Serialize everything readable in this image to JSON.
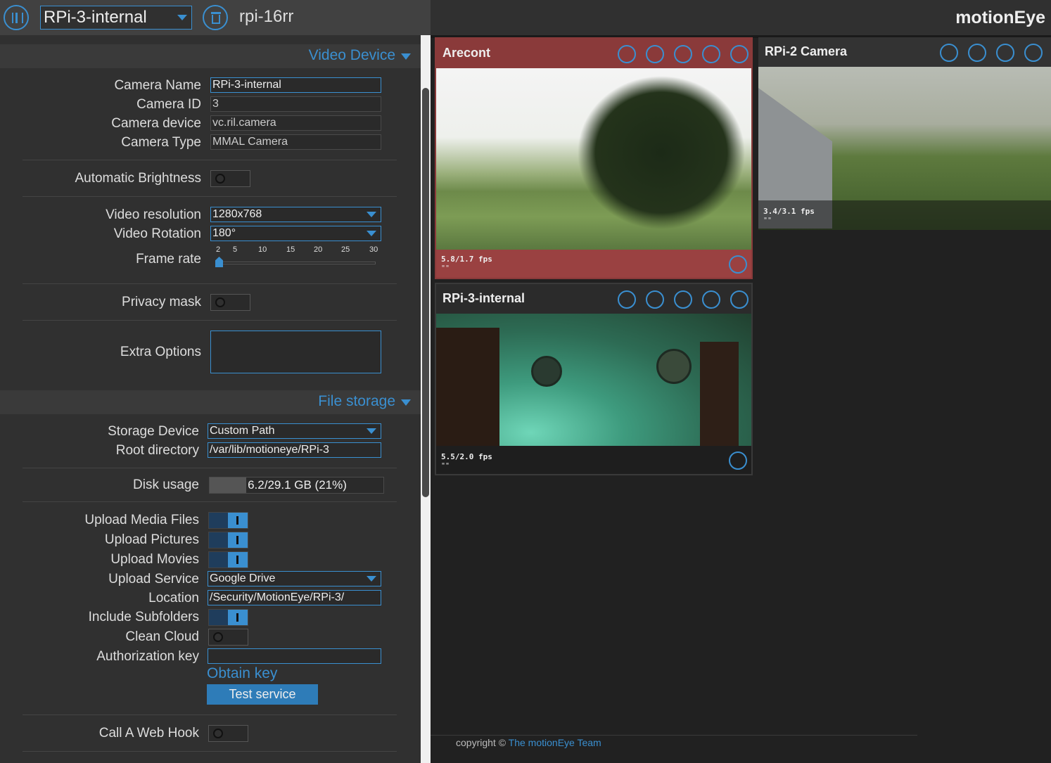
{
  "header": {
    "selected_camera": "RPi-3-internal",
    "host_name": "rpi-16rr",
    "brand": "motionEye"
  },
  "video_device": {
    "section_title": "Video Device",
    "camera_name_label": "Camera Name",
    "camera_name_value": "RPi-3-internal",
    "camera_id_label": "Camera ID",
    "camera_id_value": "3",
    "camera_device_label": "Camera device",
    "camera_device_value": "vc.ril.camera",
    "camera_type_label": "Camera Type",
    "camera_type_value": "MMAL Camera",
    "auto_brightness_label": "Automatic Brightness",
    "auto_brightness_on": false,
    "resolution_label": "Video resolution",
    "resolution_value": "1280x768",
    "rotation_label": "Video Rotation",
    "rotation_value": "180°",
    "frame_rate_label": "Frame rate",
    "frame_rate_ticks": [
      "2",
      "5",
      "10",
      "15",
      "20",
      "25",
      "30"
    ],
    "frame_rate_value": 2,
    "privacy_mask_label": "Privacy mask",
    "privacy_mask_on": false,
    "extra_options_label": "Extra Options",
    "extra_options_value": ""
  },
  "file_storage": {
    "section_title": "File storage",
    "storage_device_label": "Storage Device",
    "storage_device_value": "Custom Path",
    "root_dir_label": "Root directory",
    "root_dir_value": "/var/lib/motioneye/RPi-3",
    "disk_usage_label": "Disk usage",
    "disk_usage_text": "6.2/29.1 GB (21%)",
    "disk_usage_fraction": 0.21,
    "upload_media_label": "Upload Media Files",
    "upload_pictures_label": "Upload Pictures",
    "upload_movies_label": "Upload Movies",
    "upload_service_label": "Upload Service",
    "upload_service_value": "Google Drive",
    "location_label": "Location",
    "location_value": "/Security/MotionEye/RPi-3/",
    "include_subfolders_label": "Include Subfolders",
    "clean_cloud_label": "Clean Cloud",
    "auth_key_label": "Authorization key",
    "auth_key_value": "",
    "obtain_key": "Obtain key",
    "test_service": "Test service",
    "web_hook_label": "Call A Web Hook"
  },
  "cameras": [
    {
      "name": "Arecont",
      "fps": "5.8/1.7 fps",
      "sub": "\"\""
    },
    {
      "name": "RPi-2 Camera",
      "fps": "3.4/3.1 fps",
      "sub": "\"\""
    },
    {
      "name": "RPi-3-internal",
      "fps": "5.5/2.0 fps",
      "sub": "\"\""
    }
  ],
  "footer": {
    "copyright": "copyright ©",
    "team_link": "The motionEye Team"
  },
  "colors": {
    "accent": "#3a8fd0",
    "active_camera_frame": "#8a3a3a"
  }
}
